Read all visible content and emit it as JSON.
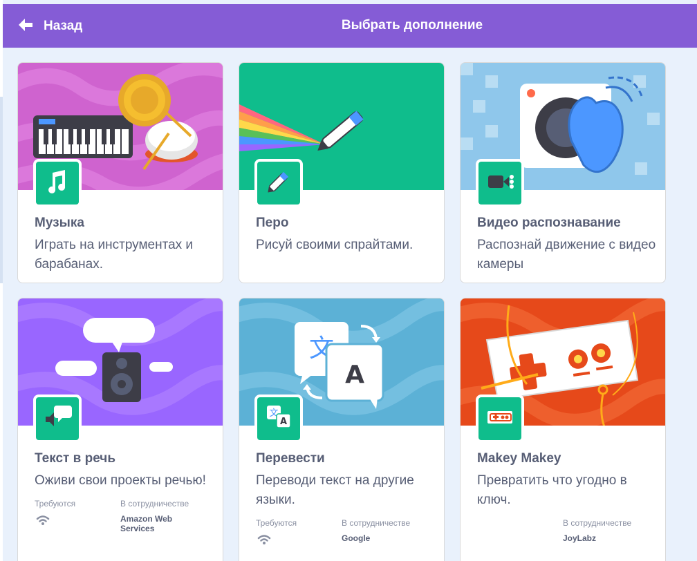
{
  "header": {
    "back_label": "Назад",
    "title": "Выбрать дополнение"
  },
  "colors": {
    "header_bg": "#855cd6",
    "page_bg": "#e9f1fc",
    "icon_bg": "#0fbd8c",
    "text": "#575e75"
  },
  "extensions": [
    {
      "name": "Музыка",
      "description": "Играть на инструментах и барабанах.",
      "icon": "music-notes-icon",
      "banner": "music-banner"
    },
    {
      "name": "Перо",
      "description": "Рисуй своими спрайтами.",
      "icon": "pen-icon",
      "banner": "pen-rainbow-banner"
    },
    {
      "name": "Видео распознавание",
      "description": "Распознай движение с видео камеры",
      "icon": "video-camera-icon",
      "banner": "video-sensing-banner"
    },
    {
      "name": "Текст в речь",
      "description": "Оживи свои проекты речью!",
      "icon": "speech-bubble-speaker-icon",
      "banner": "speaker-banner",
      "requires_label": "Требуются",
      "requires_icon": "wifi-icon",
      "collab_label": "В сотрудничестве",
      "collab_value": "Amazon Web Services"
    },
    {
      "name": "Перевести",
      "description": "Переводи текст на другие языки.",
      "icon": "translate-icon",
      "banner": "translate-banner",
      "requires_label": "Требуются",
      "requires_icon": "wifi-icon",
      "collab_label": "В сотрудничестве",
      "collab_value": "Google"
    },
    {
      "name": "Makey Makey",
      "description": "Превратить что угодно в ключ.",
      "icon": "makey-makey-icon",
      "banner": "makey-makey-banner",
      "collab_label": "В сотрудничестве",
      "collab_value": "JoyLabz"
    }
  ]
}
